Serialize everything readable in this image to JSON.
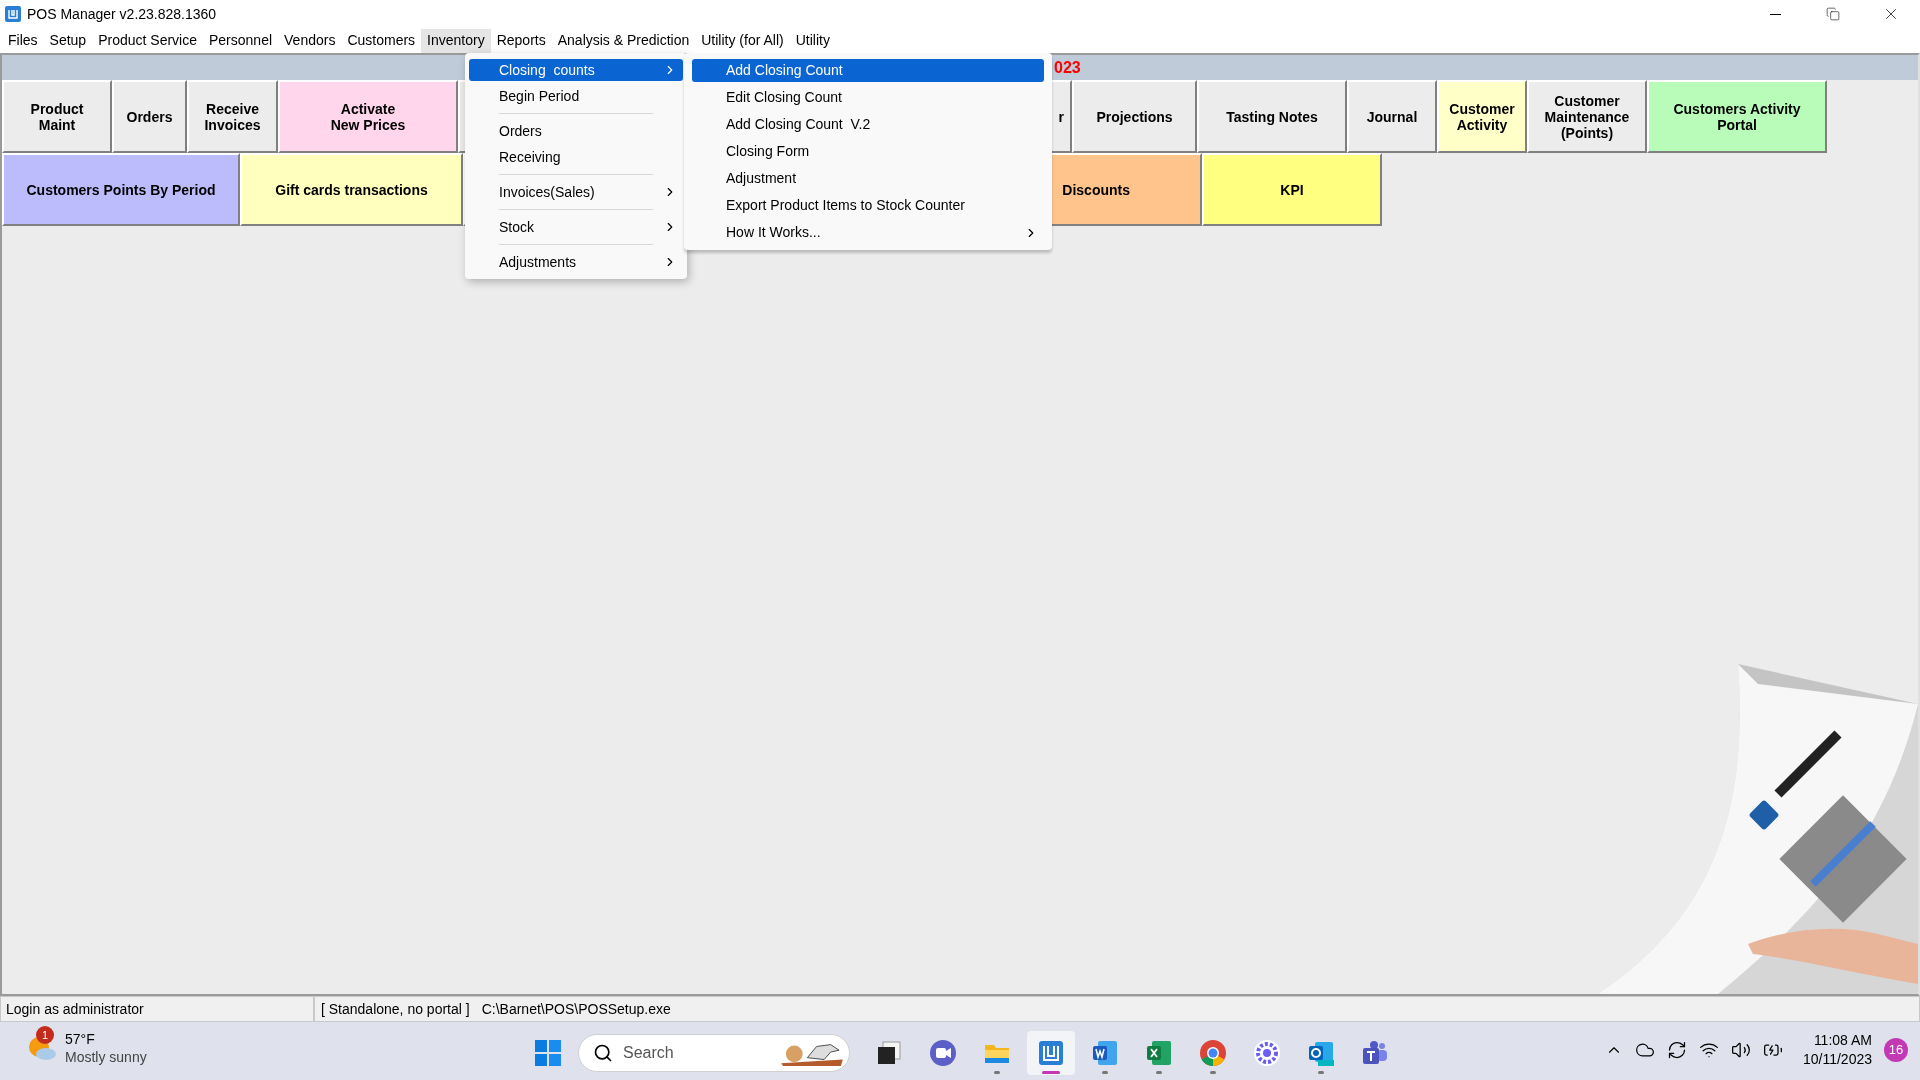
{
  "window": {
    "title": "POS Manager v2.23.828.1360"
  },
  "menu_bar": [
    {
      "label": "Files",
      "selected": false
    },
    {
      "label": "Setup",
      "selected": false
    },
    {
      "label": "Product Service",
      "selected": false
    },
    {
      "label": "Personnel",
      "selected": false
    },
    {
      "label": "Vendors",
      "selected": false
    },
    {
      "label": "Customers",
      "selected": false
    },
    {
      "label": "Inventory",
      "selected": true
    },
    {
      "label": "Reports",
      "selected": false
    },
    {
      "label": "Analysis & Prediction",
      "selected": false
    },
    {
      "label": "Utility (for All)",
      "selected": false
    },
    {
      "label": "Utility",
      "selected": false
    }
  ],
  "header_strip": {
    "text": "023"
  },
  "button_rows": [
    [
      {
        "lines": [
          "Product",
          "Maint"
        ],
        "color": "#ececec",
        "kind": "full"
      },
      {
        "lines": [
          "Orders"
        ],
        "color": "#ececec",
        "kind": "full"
      },
      {
        "lines": [
          "Receive",
          "Invoices"
        ],
        "color": "#ececec",
        "kind": "full"
      },
      {
        "lines": [
          "Activate",
          "New Prices"
        ],
        "color": "#ffd6ec",
        "kind": "full"
      },
      {
        "lines": [
          "r"
        ],
        "color": "#ececec",
        "kind": "covered"
      },
      {
        "lines": [
          "Projections"
        ],
        "color": "#ececec",
        "kind": "full"
      },
      {
        "lines": [
          "Tasting Notes"
        ],
        "color": "#ececec",
        "kind": "full"
      },
      {
        "lines": [
          "Journal"
        ],
        "color": "#ececec",
        "kind": "full"
      },
      {
        "lines": [
          "Customer",
          "Activity"
        ],
        "color": "#ffffc8",
        "kind": "full"
      },
      {
        "lines": [
          "Customer",
          "Maintenance",
          "(Points)"
        ],
        "color": "#ececec",
        "kind": "full"
      },
      {
        "lines": [
          "Customers Activity",
          "Portal"
        ],
        "color": "#b9fcb9",
        "kind": "full"
      }
    ],
    [
      {
        "lines": [
          "Customers Points By Period"
        ],
        "color": "#bcbcfc",
        "kind": "full"
      },
      {
        "lines": [
          "Gift cards transactions"
        ],
        "color": "#ffffbe",
        "kind": "full"
      },
      {
        "lines": [
          "Discounts"
        ],
        "color": "#ffc48c",
        "kind": "covered"
      },
      {
        "lines": [
          "KPI"
        ],
        "color": "#ffff80",
        "kind": "full"
      }
    ]
  ],
  "inventory_menu": [
    {
      "kind": "item",
      "label": "Closing  counts",
      "submenu": true,
      "selected": true
    },
    {
      "kind": "item",
      "label": "Begin Period",
      "submenu": false,
      "selected": false
    },
    {
      "kind": "separator"
    },
    {
      "kind": "item",
      "label": "Orders",
      "submenu": false,
      "selected": false
    },
    {
      "kind": "item",
      "label": "Receiving",
      "submenu": false,
      "selected": false
    },
    {
      "kind": "separator"
    },
    {
      "kind": "item",
      "label": "Invoices(Sales)",
      "submenu": true,
      "selected": false
    },
    {
      "kind": "separator"
    },
    {
      "kind": "item",
      "label": "Stock",
      "submenu": true,
      "selected": false
    },
    {
      "kind": "separator"
    },
    {
      "kind": "item",
      "label": "Adjustments",
      "submenu": true,
      "selected": false
    }
  ],
  "closing_counts_submenu": [
    {
      "label": "Add Closing Count",
      "submenu": false,
      "selected": true
    },
    {
      "label": "Edit Closing Count",
      "submenu": false,
      "selected": false
    },
    {
      "label": "Add Closing Count  V.2",
      "submenu": false,
      "selected": false
    },
    {
      "label": "Closing Form",
      "submenu": false,
      "selected": false
    },
    {
      "label": "Adjustment",
      "submenu": false,
      "selected": false
    },
    {
      "label": "Export Product Items to Stock Counter",
      "submenu": false,
      "selected": false
    },
    {
      "label": "How It Works...",
      "submenu": true,
      "selected": false
    }
  ],
  "status_bar": {
    "login": "Login as administrator",
    "mode": "[ Standalone, no portal ]",
    "path": "C:\\Barnet\\POS\\POSSetup.exe"
  },
  "taskbar": {
    "weather": {
      "temperature": "57°F",
      "condition": "Mostly sunny",
      "badge": "1"
    },
    "search": {
      "placeholder": "Search"
    },
    "apps": [
      {
        "kind": "taskview",
        "running": false,
        "selected": false
      },
      {
        "kind": "meet",
        "running": false,
        "selected": false
      },
      {
        "kind": "explorer",
        "running": true,
        "selected": false
      },
      {
        "kind": "pos",
        "running": true,
        "selected": true
      },
      {
        "kind": "word",
        "running": true,
        "selected": false
      },
      {
        "kind": "excel",
        "running": true,
        "selected": false
      },
      {
        "kind": "chrome",
        "running": true,
        "selected": false
      },
      {
        "kind": "flower",
        "running": false,
        "selected": false
      },
      {
        "kind": "outlook",
        "running": true,
        "selected": false
      },
      {
        "kind": "teams",
        "running": false,
        "selected": false
      }
    ],
    "time": "11:08 AM",
    "date": "10/11/2023",
    "notification_count": "16"
  }
}
